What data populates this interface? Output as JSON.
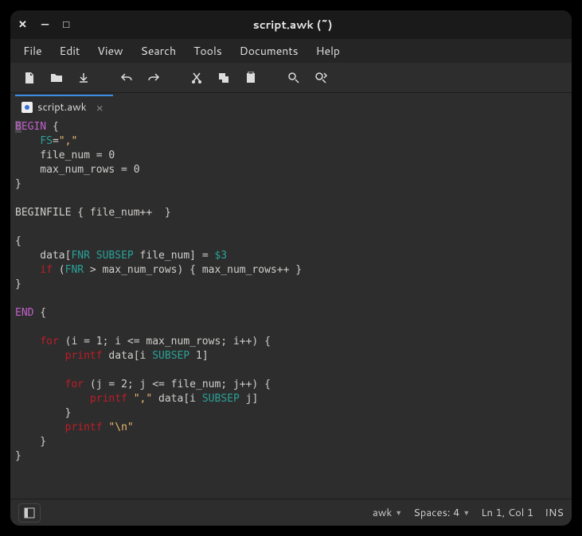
{
  "window": {
    "title": "script.awk (~)"
  },
  "menu": {
    "file": "File",
    "edit": "Edit",
    "view": "View",
    "search": "Search",
    "tools": "Tools",
    "documents": "Documents",
    "help": "Help"
  },
  "tab": {
    "label": "script.awk"
  },
  "code": {
    "lines": [
      [
        [
          "kw1",
          "BEGIN"
        ],
        [
          "pln",
          " {"
        ]
      ],
      [
        [
          "pln",
          "    "
        ],
        [
          "var",
          "FS"
        ],
        [
          "pln",
          "="
        ],
        [
          "str",
          "\",\""
        ]
      ],
      [
        [
          "pln",
          "    file_num = 0"
        ]
      ],
      [
        [
          "pln",
          "    max_num_rows = 0"
        ]
      ],
      [
        [
          "pln",
          "}"
        ]
      ],
      [
        [
          "pln",
          ""
        ]
      ],
      [
        [
          "pln",
          "BEGINFILE { file_num++  }"
        ]
      ],
      [
        [
          "pln",
          ""
        ]
      ],
      [
        [
          "pln",
          "{"
        ]
      ],
      [
        [
          "pln",
          "    data["
        ],
        [
          "var",
          "FNR"
        ],
        [
          "pln",
          " "
        ],
        [
          "var",
          "SUBSEP"
        ],
        [
          "pln",
          " file_num] = "
        ],
        [
          "var",
          "$3"
        ]
      ],
      [
        [
          "pln",
          "    "
        ],
        [
          "kw2",
          "if"
        ],
        [
          "pln",
          " ("
        ],
        [
          "var",
          "FNR"
        ],
        [
          "pln",
          " > max_num_rows) { max_num_rows++ }"
        ]
      ],
      [
        [
          "pln",
          "}"
        ]
      ],
      [
        [
          "pln",
          ""
        ]
      ],
      [
        [
          "kw1",
          "END"
        ],
        [
          "pln",
          " {"
        ]
      ],
      [
        [
          "pln",
          ""
        ]
      ],
      [
        [
          "pln",
          "    "
        ],
        [
          "kw2",
          "for"
        ],
        [
          "pln",
          " (i = 1; i <= max_num_rows; i++) {"
        ]
      ],
      [
        [
          "pln",
          "        "
        ],
        [
          "kw2",
          "printf"
        ],
        [
          "pln",
          " data[i "
        ],
        [
          "var",
          "SUBSEP"
        ],
        [
          "pln",
          " 1]"
        ]
      ],
      [
        [
          "pln",
          ""
        ]
      ],
      [
        [
          "pln",
          "        "
        ],
        [
          "kw2",
          "for"
        ],
        [
          "pln",
          " (j = 2; j <= file_num; j++) {"
        ]
      ],
      [
        [
          "pln",
          "            "
        ],
        [
          "kw2",
          "printf"
        ],
        [
          "pln",
          " "
        ],
        [
          "str",
          "\",\""
        ],
        [
          "pln",
          " data[i "
        ],
        [
          "var",
          "SUBSEP"
        ],
        [
          "pln",
          " j]"
        ]
      ],
      [
        [
          "pln",
          "        }"
        ]
      ],
      [
        [
          "pln",
          "        "
        ],
        [
          "kw2",
          "printf"
        ],
        [
          "pln",
          " "
        ],
        [
          "str",
          "\"\\n\""
        ]
      ],
      [
        [
          "pln",
          "    }"
        ]
      ],
      [
        [
          "pln",
          "}"
        ]
      ]
    ]
  },
  "status": {
    "lang": "awk",
    "spaces": "Spaces: 4",
    "position": "Ln 1, Col 1",
    "mode": "INS"
  }
}
